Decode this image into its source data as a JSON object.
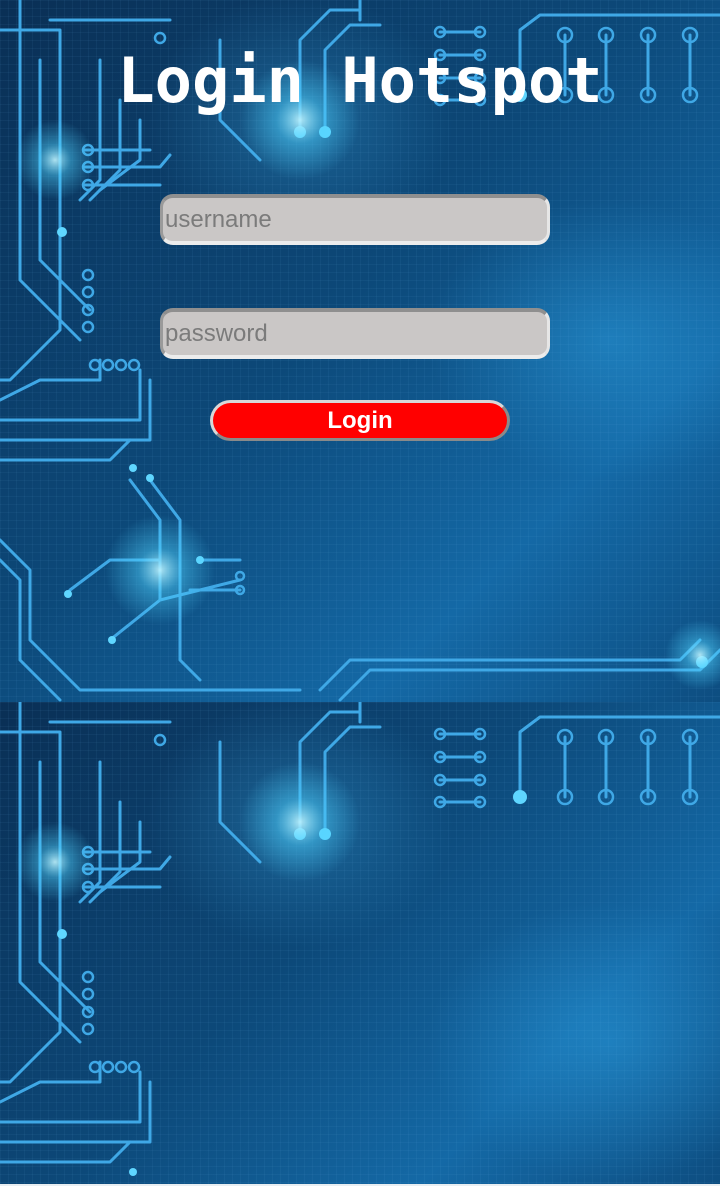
{
  "page": {
    "title": "Login Hotspot"
  },
  "form": {
    "username_placeholder": "username",
    "password_placeholder": "password",
    "login_label": "Login"
  },
  "colors": {
    "background_blue": "#0c4878",
    "circuit_glow": "#4fd3ff",
    "button_red": "#ff0000",
    "field_gray": "#cac7c6"
  },
  "icons": {
    "background": "circuit-board-pattern"
  }
}
